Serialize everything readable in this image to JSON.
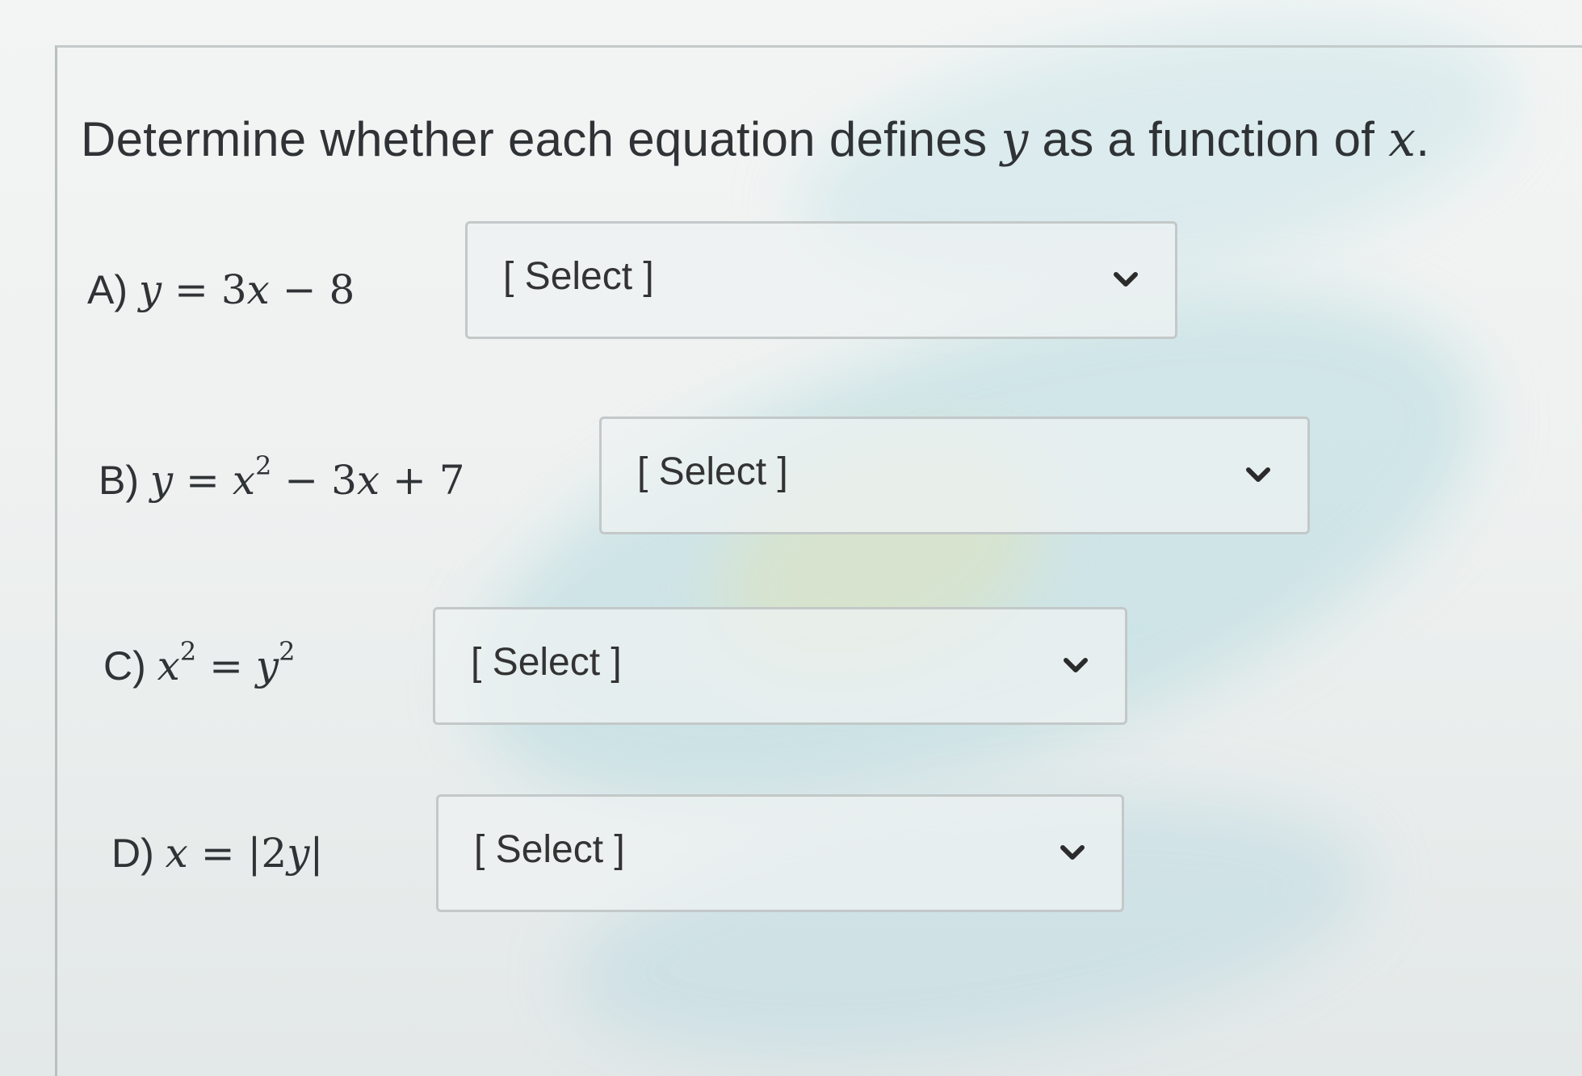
{
  "prompt": {
    "text_before": "Determine whether each equation defines ",
    "var_y": "y",
    "text_middle": " as a function of ",
    "var_x": "x",
    "text_end": "."
  },
  "items": [
    {
      "letter": "A)",
      "select_value": "[ Select ]"
    },
    {
      "letter": "B)",
      "select_value": "[ Select ]"
    },
    {
      "letter": "C)",
      "select_value": "[ Select ]"
    },
    {
      "letter": "D)",
      "select_value": "[ Select ]"
    }
  ],
  "icons": {
    "dropdown": "chevron-down-icon"
  }
}
